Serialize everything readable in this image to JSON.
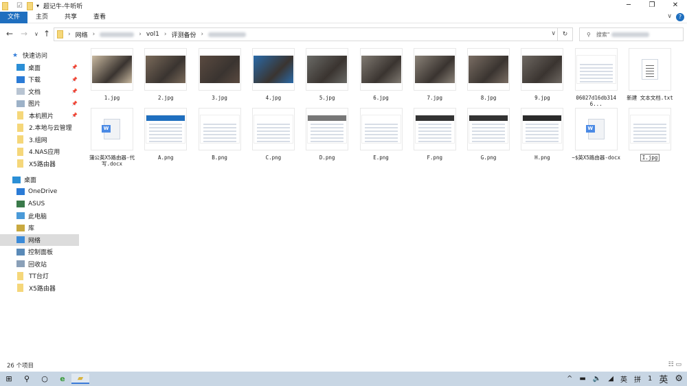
{
  "window": {
    "title": "超记牛-牛听听",
    "minimize": "─",
    "maximize": "❐",
    "close": "✕"
  },
  "ribbon": {
    "tabs": [
      "文件",
      "主页",
      "共享",
      "查看"
    ],
    "expand": "∨",
    "help": "?"
  },
  "nav": {
    "back": "←",
    "forward": "→",
    "recent": "∨",
    "up": "↑",
    "breadcrumb": [
      "网络",
      "vol1",
      "评测备份"
    ],
    "dropdown": "∨",
    "refresh": "↻",
    "search_placeholder": "搜索\""
  },
  "sidebar": {
    "items": [
      {
        "label": "快速访问",
        "icon": "star-icon",
        "color": "#2f7bd8"
      },
      {
        "label": "桌面",
        "icon": "desktop-icon",
        "color": "#2b8fd6",
        "pin": true
      },
      {
        "label": "下载",
        "icon": "download-icon",
        "color": "#2b7bd6",
        "pin": true
      },
      {
        "label": "文档",
        "icon": "document-icon",
        "color": "#b8c4d2",
        "pin": true
      },
      {
        "label": "图片",
        "icon": "pictures-icon",
        "color": "#9db2c8",
        "pin": true
      },
      {
        "label": "本机照片",
        "icon": "folder-icon",
        "color": "#f5d77a",
        "pin": true
      },
      {
        "label": "2.本地与云管理",
        "icon": "folder-icon",
        "color": "#f5d77a"
      },
      {
        "label": "3.组网",
        "icon": "folder-icon",
        "color": "#f5d77a"
      },
      {
        "label": "4.NAS应用",
        "icon": "folder-icon",
        "color": "#f5d77a"
      },
      {
        "label": "X5路由器",
        "icon": "folder-icon",
        "color": "#f5d77a"
      },
      {
        "label": "桌面",
        "icon": "desktop-icon",
        "color": "#2b8fd6"
      },
      {
        "label": "OneDrive",
        "icon": "cloud-icon",
        "color": "#2b7bd6"
      },
      {
        "label": "ASUS",
        "icon": "user-icon",
        "color": "#3a7a4a"
      },
      {
        "label": "此电脑",
        "icon": "computer-icon",
        "color": "#4a9ad8"
      },
      {
        "label": "库",
        "icon": "library-icon",
        "color": "#c9a940"
      },
      {
        "label": "网络",
        "icon": "network-icon",
        "color": "#3a8ad8",
        "selected": true
      },
      {
        "label": "控制面板",
        "icon": "control-panel-icon",
        "color": "#5a8ab8"
      },
      {
        "label": "回收站",
        "icon": "recycle-bin-icon",
        "color": "#8aa0b8"
      },
      {
        "label": "TT台灯",
        "icon": "folder-icon",
        "color": "#f5d77a"
      },
      {
        "label": "X5路由器",
        "icon": "folder-icon",
        "color": "#f5d77a"
      }
    ]
  },
  "files": [
    {
      "name": "1.jpg",
      "kind": "photo",
      "c": "#c9b9a0"
    },
    {
      "name": "2.jpg",
      "kind": "photo",
      "c": "#7a6a5a"
    },
    {
      "name": "3.jpg",
      "kind": "photo",
      "c": "#5a4a40"
    },
    {
      "name": "4.jpg",
      "kind": "photo",
      "c": "#2a6aa8"
    },
    {
      "name": "5.jpg",
      "kind": "photo",
      "c": "#6a6a66"
    },
    {
      "name": "6.jpg",
      "kind": "photo",
      "c": "#807a72"
    },
    {
      "name": "7.jpg",
      "kind": "photo",
      "c": "#8a8278"
    },
    {
      "name": "8.jpg",
      "kind": "photo",
      "c": "#7a6e64"
    },
    {
      "name": "9.jpg",
      "kind": "photo",
      "c": "#6e6862"
    },
    {
      "name": "06027d16db3146...",
      "kind": "shot"
    },
    {
      "name": "新建 文本文档.txt",
      "kind": "txt"
    },
    {
      "name": "蒲公英X5路由器-代写.docx",
      "kind": "doc"
    },
    {
      "name": "A.png",
      "kind": "shot",
      "c": "#1f6fbf"
    },
    {
      "name": "B.png",
      "kind": "shot"
    },
    {
      "name": "C.png",
      "kind": "shot"
    },
    {
      "name": "D.png",
      "kind": "shot",
      "c": "#777777"
    },
    {
      "name": "E.png",
      "kind": "shot"
    },
    {
      "name": "F.png",
      "kind": "shot",
      "c": "#333333"
    },
    {
      "name": "G.png",
      "kind": "shot",
      "c": "#333333"
    },
    {
      "name": "H.png",
      "kind": "shot",
      "c": "#2a2a2a"
    },
    {
      "name": "~$英X5路由器-docx",
      "kind": "doc"
    },
    {
      "name": "I.jpg",
      "kind": "shot",
      "selected": true
    }
  ],
  "status": {
    "count": "26 个项目",
    "views": "☷ ▭"
  },
  "taskbar": {
    "start": "⊞",
    "search": "⚲",
    "cortana": "○",
    "ie": "e",
    "explorer": "▰",
    "tray": [
      "^",
      "▬",
      "🔈",
      "◢",
      "英",
      "拼",
      "1",
      "英",
      "⚙"
    ]
  }
}
